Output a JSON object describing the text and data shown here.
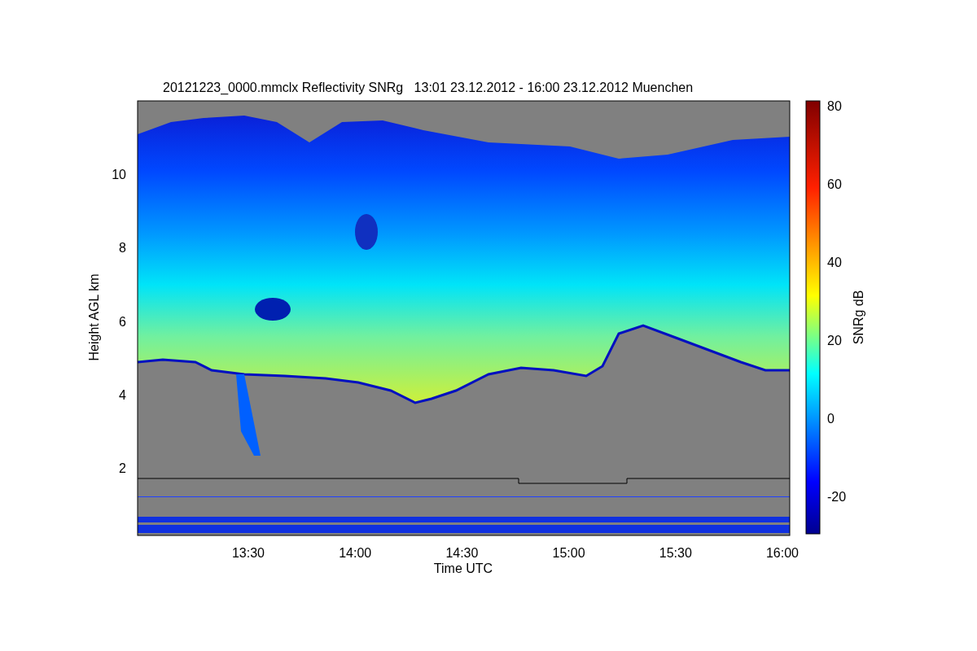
{
  "title": "20121223_0000.mmclx Reflectivity SNRg   13:01 23.12.2012 - 16:00 23.12.2012 Muenchen",
  "y_axis": {
    "label": "Height AGL km",
    "ticks": [
      "10",
      "8",
      "6",
      "4",
      "2"
    ]
  },
  "x_axis": {
    "label": "Time UTC",
    "ticks": [
      "13:30",
      "14:00",
      "14:30",
      "15:00",
      "15:30",
      "16:00"
    ]
  },
  "colorbar": {
    "label": "SNRg dB",
    "ticks": [
      "80",
      "60",
      "40",
      "20",
      "0",
      "-20"
    ]
  }
}
